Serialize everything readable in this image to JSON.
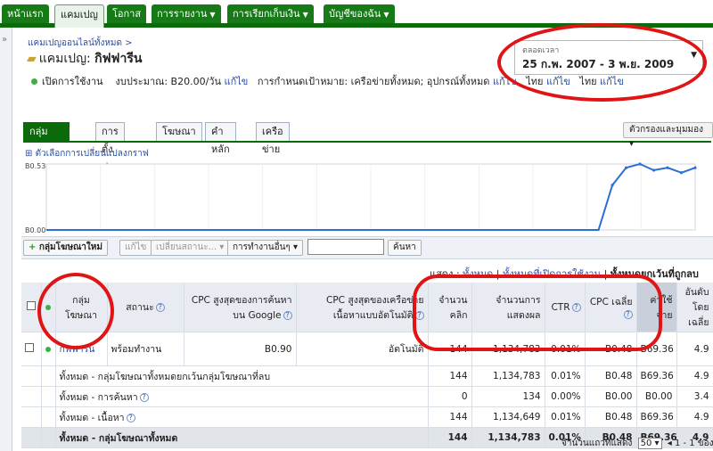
{
  "nav": {
    "tabs": [
      {
        "label": "หน้าแรก",
        "active": false
      },
      {
        "label": "แคมเปญ",
        "active": true
      },
      {
        "label": "โอกาส",
        "active": false
      },
      {
        "label": "การรายงาน",
        "active": false,
        "dropdown": true
      },
      {
        "label": "การเรียกเก็บเงิน",
        "active": false,
        "dropdown": true
      },
      {
        "label": "บัญชีของฉัน",
        "active": false,
        "dropdown": true
      }
    ]
  },
  "leftbar": {
    "toggle": "»"
  },
  "breadcrumb": "แคมเปญออนไลน์ทั้งหมด >",
  "campaign": {
    "prefix": "แคมเปญ:",
    "name": "กิฟฟารีน",
    "status_label": "เปิดการใช้งาน",
    "budget_label": "งบประมาณ:",
    "budget_value": "B20.00/วัน",
    "edit": "แก้ไข",
    "targeting_label": "การกำหนดเป้าหมาย:",
    "targeting_value": "เครือข่ายทั้งหมด; อุปกรณ์ทั้งหมด",
    "lang1": "ไทย",
    "lang2": "ไทย"
  },
  "date_range": {
    "label": "ตลอดเวลา",
    "value": "25 ก.พ. 2007 - 3 พ.ย. 2009"
  },
  "subtabs": [
    {
      "label": "กลุ่มโฆษณา",
      "active": true
    },
    {
      "label": "การตั้งค่า",
      "active": false
    },
    {
      "label": "โฆษณา",
      "active": false
    },
    {
      "label": "คำหลัก",
      "active": false
    },
    {
      "label": "เครือข่าย",
      "active": false
    }
  ],
  "filter_button": "ตัวกรองและมุมมอง",
  "graph_options": "ตัวเลือกการเปลี่ยนแปลงกราฟ",
  "chart_data": {
    "type": "line",
    "y_max_label": "B0.53",
    "y_min_label": "B0.00",
    "ylim": [
      0,
      0.53
    ],
    "series": [
      {
        "values": [
          0,
          0,
          0,
          0,
          0,
          0,
          0,
          0,
          0,
          0,
          0,
          0,
          0,
          0,
          0,
          0,
          0,
          0,
          0,
          0,
          0,
          0,
          0,
          0,
          0,
          0,
          0,
          0,
          0,
          0,
          0,
          0,
          0,
          0,
          0,
          0,
          0,
          0,
          0,
          0,
          0,
          0.36,
          0.5,
          0.53,
          0.48,
          0.5,
          0.46,
          0.5
        ]
      }
    ],
    "color": "#2a6fd6"
  },
  "toolbar": {
    "new_group": "กลุ่มโฆษณาใหม่",
    "edit": "แก้ไข",
    "change_status": "เปลี่ยนสถานะ...",
    "more_actions": "การทำงานอื่นๆ",
    "search": "ค้นหา"
  },
  "show": {
    "label": "แสดง :",
    "all": "ทั้งหมด",
    "enabled": "ทั้งหมดที่เปิดการใช้งาน",
    "not_deleted": "ทั้งหมดยกเว้นที่ถูกลบ"
  },
  "table": {
    "headers": {
      "group": "กลุ่มโฆษณา",
      "status": "สถานะ",
      "max_cpc_search": "CPC สูงสุดของการค้นหาบน Google",
      "max_cpc_content": "CPC สูงสุดของเครือข่ายเนื้อหาแบบอัตโนมัติ",
      "clicks": "จำนวนคลิก",
      "impr": "จำนวนการแสดงผล",
      "ctr": "CTR",
      "avg_cpc": "CPC เฉลี่ย",
      "cost": "ค่าใช้จ่าย",
      "avg_pos": "อันดับโดยเฉลี่ย"
    },
    "rows": [
      {
        "group": "กิฟฟารีน",
        "status": "พร้อมทำงาน",
        "max_cpc": "B0.90",
        "max_cpc_content": "อัตโนมัติ",
        "clicks": "144",
        "impr": "1,134,783",
        "ctr": "0.01%",
        "avg_cpc": "B0.48",
        "cost": "B69.36",
        "avg_pos": "4.9"
      }
    ],
    "subtotals": [
      {
        "label": "ทั้งหมด - กลุ่มโฆษณาทั้งหมดยกเว้นกลุ่มโฆษณาที่ลบ",
        "clicks": "144",
        "impr": "1,134,783",
        "ctr": "0.01%",
        "avg_cpc": "B0.48",
        "cost": "B69.36",
        "avg_pos": "4.9"
      },
      {
        "label": "ทั้งหมด - การค้นหา",
        "clicks": "0",
        "impr": "134",
        "ctr": "0.00%",
        "avg_cpc": "B0.00",
        "cost": "B0.00",
        "avg_pos": "3.4"
      },
      {
        "label": "ทั้งหมด - เนื้อหา",
        "clicks": "144",
        "impr": "1,134,649",
        "ctr": "0.01%",
        "avg_cpc": "B0.48",
        "cost": "B69.36",
        "avg_pos": "4.9"
      }
    ],
    "total": {
      "label": "ทั้งหมด - กลุ่มโฆษณาทั้งหมด",
      "clicks": "144",
      "impr": "1,134,783",
      "ctr": "0.01%",
      "avg_cpc": "B0.48",
      "cost": "B69.36",
      "avg_pos": "4.9"
    }
  },
  "pager": {
    "label": "จำนวนแถวที่แสดง",
    "size": "50",
    "range": "1 - 1 ของ 1"
  },
  "colors": {
    "accent": "#0b6b0b",
    "annotation": "#e01414",
    "link": "#2a4ea6"
  }
}
